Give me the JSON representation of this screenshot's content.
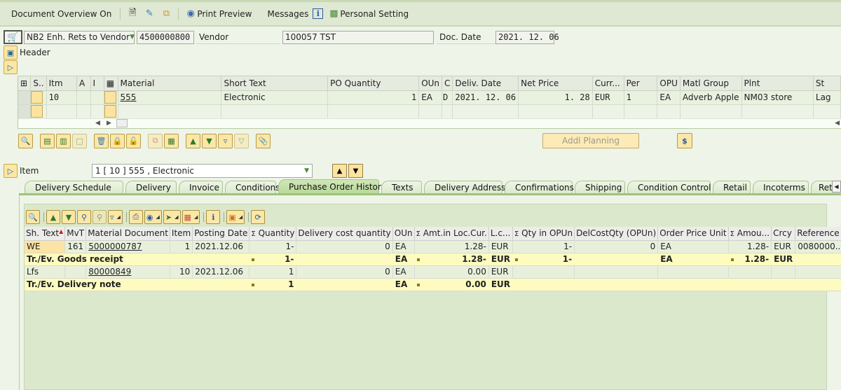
{
  "toolbar": {
    "document_overview": "Document Overview On",
    "print_preview": "Print Preview",
    "messages": "Messages",
    "personal_setting": "Personal Setting",
    "icons": [
      "new-document-icon",
      "display-change-icon",
      "other-document-icon",
      "print-preview-icon",
      "info-icon",
      "personal-setting-icon"
    ]
  },
  "header": {
    "doc_type": "NB2 Enh. Rets to Vendor",
    "po_number": "4500000800",
    "vendor_label": "Vendor",
    "vendor_value": "100057 TST",
    "doc_date_label": "Doc. Date",
    "doc_date_value": "2021. 12. 06",
    "header_label": "Header"
  },
  "item_grid": {
    "columns": [
      "S..",
      "Itm",
      "A",
      "I",
      "",
      "Material",
      "Short Text",
      "PO Quantity",
      "OUn",
      "C",
      "Deliv. Date",
      "Net Price",
      "Curr...",
      "Per",
      "OPU",
      "Matl Group",
      "Plnt",
      "St"
    ],
    "rows": [
      {
        "item": "10",
        "material": "555",
        "short_text": "Electronic",
        "po_quantity": "1",
        "oun": "EA",
        "c": "D",
        "deliv_date": "2021. 12. 06",
        "net_price": "1. 28",
        "currency": "EUR",
        "per": "1",
        "opu": "EA",
        "matl_group": "Adverb Apple",
        "plant": "NM03 store",
        "storage": "Lag"
      }
    ]
  },
  "buttons": {
    "addl_planning": "Addl Planning"
  },
  "item_selector": {
    "label": "Item",
    "value": "1 [ 10 ] 555 , Electronic"
  },
  "tabs": [
    {
      "label": "Delivery Schedule",
      "active": false
    },
    {
      "label": "Delivery",
      "active": false
    },
    {
      "label": "Invoice",
      "active": false
    },
    {
      "label": "Conditions",
      "active": false
    },
    {
      "label": "Purchase Order History",
      "active": true
    },
    {
      "label": "Texts",
      "active": false
    },
    {
      "label": "Delivery Address",
      "active": false
    },
    {
      "label": "Confirmations",
      "active": false
    },
    {
      "label": "Shipping",
      "active": false
    },
    {
      "label": "Condition Control",
      "active": false
    },
    {
      "label": "Retail",
      "active": false
    },
    {
      "label": "Incoterms",
      "active": false
    },
    {
      "label": "Ret...",
      "active": false
    }
  ],
  "history": {
    "columns": [
      "Sh. Text",
      "MvT",
      "Material Document",
      "Item",
      "Posting Date",
      "Σ Quantity",
      "Delivery cost quantity",
      "OUn",
      "Σ Amt.in Loc.Cur.",
      "L.c...",
      "Σ Qty in OPUn",
      "DelCostQty (OPUn)",
      "Order Price Unit",
      "Σ Amou...",
      "Crcy",
      "Reference"
    ],
    "rows": [
      {
        "type": "detail",
        "sh_text": "WE",
        "mvt": "161",
        "mat_doc": "5000000787",
        "item": "1",
        "posting_date": "2021.12.06",
        "quantity": "1-",
        "del_cost_qty": "0",
        "oun": "EA",
        "amt_loc": "1.28-",
        "loc_cur": "EUR",
        "qty_opun": "1-",
        "del_cost_opun": "0",
        "order_price_unit": "EA",
        "amount": "1.28-",
        "crcy": "EUR",
        "reference": "0080000..."
      },
      {
        "type": "sum",
        "label": "Tr./Ev. Goods receipt",
        "quantity": "1-",
        "oun": "EA",
        "amt_loc": "1.28-",
        "loc_cur": "EUR",
        "qty_opun": "1-",
        "order_price_unit": "EA",
        "amount": "1.28-",
        "crcy": "EUR"
      },
      {
        "type": "detail",
        "sh_text": "Lfs",
        "mvt": "",
        "mat_doc": "80000849",
        "item": "10",
        "posting_date": "2021.12.06",
        "quantity": "1",
        "del_cost_qty": "0",
        "oun": "EA",
        "amt_loc": "0.00",
        "loc_cur": "EUR",
        "qty_opun": "",
        "del_cost_opun": "",
        "order_price_unit": "",
        "amount": "",
        "crcy": "",
        "reference": ""
      },
      {
        "type": "sum",
        "label": "Tr./Ev. Delivery note",
        "quantity": "1",
        "oun": "EA",
        "amt_loc": "0.00",
        "loc_cur": "EUR",
        "qty_opun": "",
        "order_price_unit": "",
        "amount": "",
        "crcy": ""
      }
    ]
  },
  "colors": {
    "highlight_tab": "#b9d99a",
    "annotation_underline": "#e02020",
    "sum_row": "#fdfbbf"
  }
}
